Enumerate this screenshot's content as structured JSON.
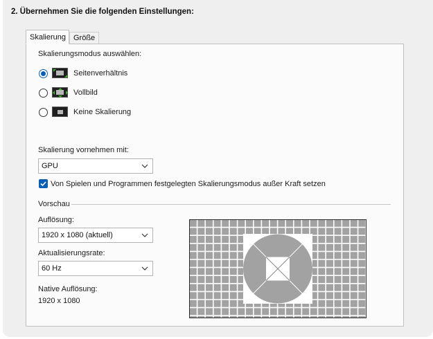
{
  "step_title": "2. Übernehmen Sie die folgenden Einstellungen:",
  "tabs": [
    {
      "label": "Skalierung",
      "active": true
    },
    {
      "label": "Größe",
      "active": false
    }
  ],
  "scaling_mode": {
    "label": "Skalierungsmodus auswählen:",
    "options": [
      {
        "label": "Seitenverhältnis",
        "selected": true,
        "icon": "aspect-ratio-icon"
      },
      {
        "label": "Vollbild",
        "selected": false,
        "icon": "fullscreen-icon"
      },
      {
        "label": "Keine Skalierung",
        "selected": false,
        "icon": "no-scaling-icon"
      }
    ]
  },
  "perform_scaling": {
    "label": "Skalierung vornehmen mit:",
    "value": "GPU"
  },
  "override": {
    "checked": true,
    "label": "Von Spielen und Programmen festgelegten Skalierungsmodus außer Kraft setzen"
  },
  "preview": {
    "group_label": "Vorschau",
    "resolution_label": "Auflösung:",
    "resolution_value": "1920 x 1080 (aktuell)",
    "refresh_label": "Aktualisierungsrate:",
    "refresh_value": "60 Hz",
    "native_label": "Native Auflösung:",
    "native_value": "1920 x 1080"
  },
  "colors": {
    "accent": "#0a5fb4",
    "icon_green": "#3fae2a"
  }
}
